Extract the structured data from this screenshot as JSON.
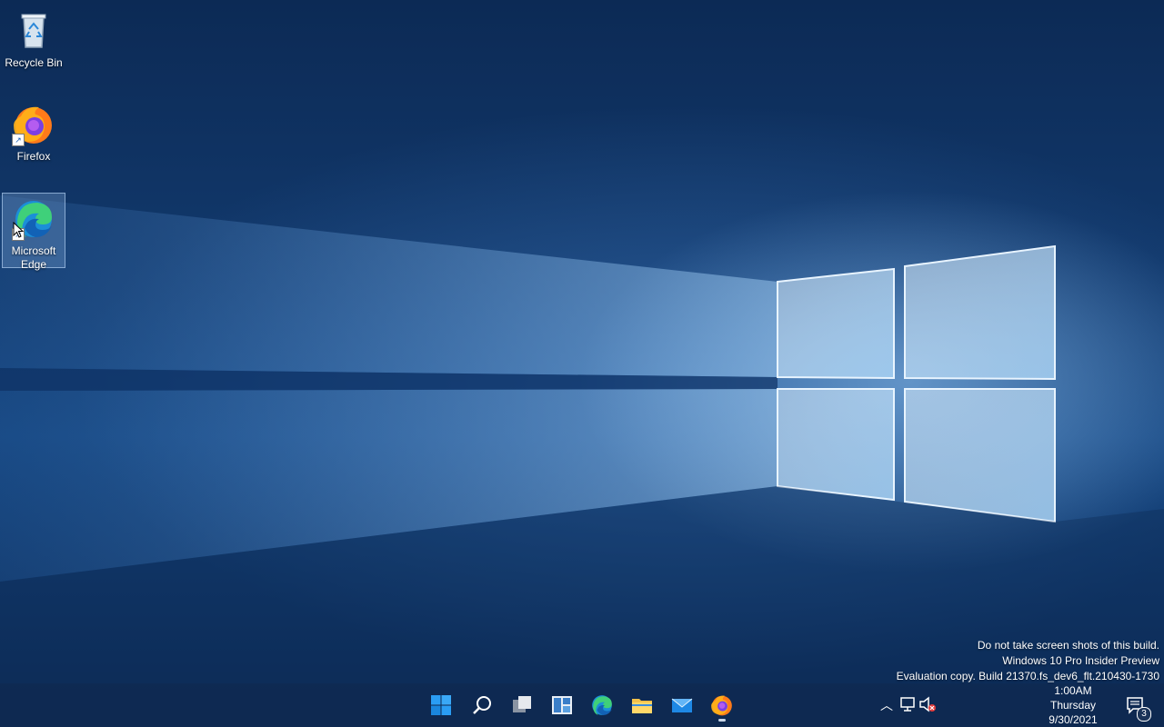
{
  "desktop_icons": [
    {
      "label": "Recycle Bin",
      "icon": "recycle-bin-icon"
    },
    {
      "label": "Firefox",
      "icon": "firefox-icon"
    },
    {
      "label": "Microsoft Edge",
      "icon": "edge-icon",
      "selected": true
    }
  ],
  "watermark": {
    "line1": "Do not take screen shots of this build.",
    "line2": "Windows 10 Pro Insider Preview",
    "line3": "Evaluation copy. Build 21370.fs_dev6_flt.210430-1730"
  },
  "taskbar": {
    "apps": [
      {
        "name": "Start",
        "icon": "start-icon"
      },
      {
        "name": "Search",
        "icon": "search-icon"
      },
      {
        "name": "Task View",
        "icon": "task-view-icon"
      },
      {
        "name": "Widgets",
        "icon": "widgets-icon"
      },
      {
        "name": "Microsoft Edge",
        "icon": "edge-icon"
      },
      {
        "name": "File Explorer",
        "icon": "file-explorer-icon"
      },
      {
        "name": "Mail",
        "icon": "mail-icon"
      },
      {
        "name": "Firefox",
        "icon": "firefox-icon",
        "running": true
      }
    ],
    "tray": {
      "clock_time": "1:00AM",
      "clock_day": "Thursday",
      "clock_date": "9/30/2021",
      "notification_count": "3"
    }
  },
  "colors": {
    "accent": "#0078d4",
    "wallpaper_dark": "#0c2a55",
    "wallpaper_light": "#9cc8ef"
  }
}
